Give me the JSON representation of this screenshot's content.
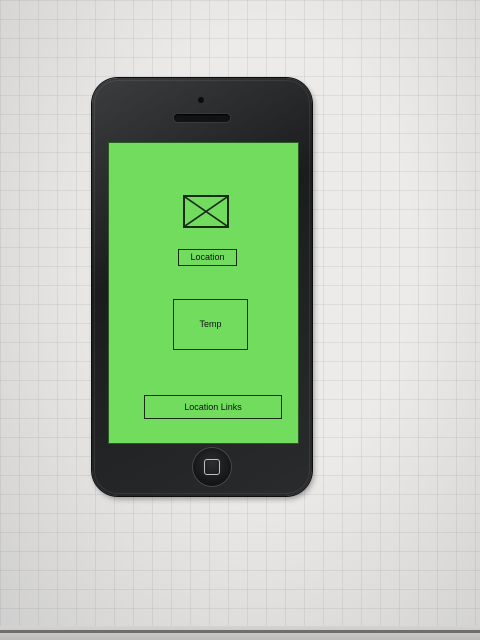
{
  "screen": {
    "background_color": "#72dc5f",
    "image_placeholder_icon": "image-placeholder-icon",
    "location_label": "Location",
    "temp_label": "Temp",
    "location_links_label": "Location Links"
  },
  "device": {
    "type": "phone-mockup",
    "home_button_icon": "home-square-icon"
  }
}
